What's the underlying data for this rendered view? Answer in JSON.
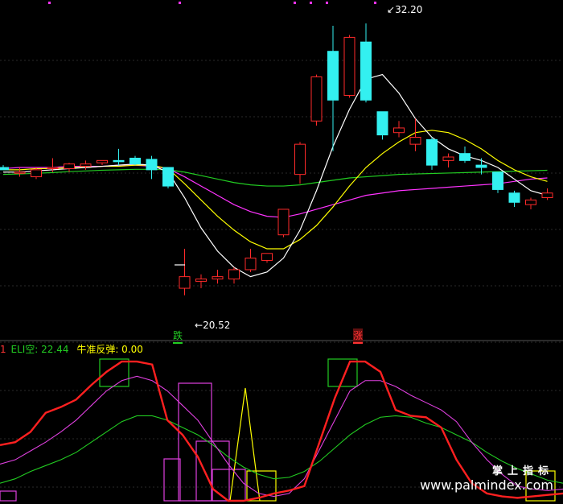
{
  "colors": {
    "background": "#000000",
    "up": "#ff2a2a",
    "down": "#33f0f0",
    "ma_white": "#ffffff",
    "ma_yellow": "#ffff00",
    "ma_magenta": "#ff33ff",
    "ma_green": "#22cc22",
    "grid": "#2a2a2a",
    "eli_red": "#ff2020",
    "eli_magenta": "#e040e0",
    "eli_green": "#22cc22",
    "box_green": "#22cc22",
    "box_yellow": "#ffff00",
    "box_magenta": "#e040e0"
  },
  "main": {
    "high_label": "32.20",
    "low_label": "20.52",
    "signal_down": "跌",
    "signal_up": "涨",
    "grid_lines": 6
  },
  "indicator": {
    "panel_index": "1",
    "name": "ELI空: 22.44",
    "value_label": "牛准反弹: 0.00"
  },
  "watermark": {
    "cn": "掌上指标",
    "url": "www.palmindex.com"
  },
  "chart_data": {
    "type": "candlestick",
    "price_range": [
      19.0,
      33.0
    ],
    "candles": [
      {
        "o": 26.0,
        "h": 26.1,
        "l": 25.9,
        "c": 25.9
      },
      {
        "o": 25.8,
        "h": 26.0,
        "l": 25.6,
        "c": 25.8
      },
      {
        "o": 25.6,
        "h": 26.0,
        "l": 25.5,
        "c": 25.9
      },
      {
        "o": 26.0,
        "h": 26.4,
        "l": 25.8,
        "c": 26.0
      },
      {
        "o": 25.95,
        "h": 26.2,
        "l": 25.8,
        "c": 26.15
      },
      {
        "o": 26.05,
        "h": 26.3,
        "l": 25.9,
        "c": 26.15
      },
      {
        "o": 26.2,
        "h": 26.3,
        "l": 26.1,
        "c": 26.3
      },
      {
        "o": 26.3,
        "h": 26.8,
        "l": 26.1,
        "c": 26.25
      },
      {
        "o": 26.4,
        "h": 26.5,
        "l": 26.1,
        "c": 26.15
      },
      {
        "o": 26.35,
        "h": 26.5,
        "l": 25.5,
        "c": 25.9
      },
      {
        "o": 26.0,
        "h": 26.0,
        "l": 25.1,
        "c": 25.2
      },
      {
        "o": 20.8,
        "h": 22.5,
        "l": 20.5,
        "c": 21.3
      },
      {
        "o": 21.1,
        "h": 21.4,
        "l": 20.8,
        "c": 21.2
      },
      {
        "o": 21.2,
        "h": 21.6,
        "l": 21.0,
        "c": 21.3
      },
      {
        "o": 21.2,
        "h": 21.7,
        "l": 21.0,
        "c": 21.6
      },
      {
        "o": 21.6,
        "h": 22.5,
        "l": 21.5,
        "c": 22.1
      },
      {
        "o": 22.0,
        "h": 22.3,
        "l": 21.9,
        "c": 22.3
      },
      {
        "o": 23.1,
        "h": 24.2,
        "l": 23.0,
        "c": 24.2
      },
      {
        "o": 25.7,
        "h": 27.1,
        "l": 25.3,
        "c": 27.0
      },
      {
        "o": 28.0,
        "h": 30.0,
        "l": 27.8,
        "c": 29.9
      },
      {
        "o": 31.0,
        "h": 32.1,
        "l": 26.7,
        "c": 28.9
      },
      {
        "o": 29.1,
        "h": 31.7,
        "l": 29.0,
        "c": 31.6
      },
      {
        "o": 31.4,
        "h": 32.2,
        "l": 28.8,
        "c": 28.9
      },
      {
        "o": 28.4,
        "h": 28.4,
        "l": 27.2,
        "c": 27.4
      },
      {
        "o": 27.5,
        "h": 28.0,
        "l": 27.3,
        "c": 27.7
      },
      {
        "o": 27.0,
        "h": 28.1,
        "l": 26.7,
        "c": 27.3
      },
      {
        "o": 27.2,
        "h": 27.3,
        "l": 25.9,
        "c": 26.1
      },
      {
        "o": 26.3,
        "h": 26.6,
        "l": 26.0,
        "c": 26.45
      },
      {
        "o": 26.6,
        "h": 26.9,
        "l": 26.2,
        "c": 26.3
      },
      {
        "o": 26.1,
        "h": 26.4,
        "l": 25.7,
        "c": 26.0
      },
      {
        "o": 25.8,
        "h": 25.8,
        "l": 24.9,
        "c": 25.05
      },
      {
        "o": 24.9,
        "h": 25.0,
        "l": 24.3,
        "c": 24.5
      },
      {
        "o": 24.4,
        "h": 24.7,
        "l": 24.2,
        "c": 24.6
      },
      {
        "o": 24.7,
        "h": 25.1,
        "l": 24.6,
        "c": 24.9
      }
    ],
    "ma_white": [
      25.8,
      25.8,
      25.85,
      25.9,
      25.95,
      26.0,
      26.05,
      26.1,
      26.15,
      26.1,
      25.8,
      24.7,
      23.4,
      22.4,
      21.7,
      21.3,
      21.5,
      22.1,
      23.3,
      25.0,
      26.9,
      28.5,
      29.8,
      30.0,
      29.2,
      28.1,
      27.3,
      26.8,
      26.5,
      26.3,
      26.0,
      25.5,
      25.0,
      24.8
    ],
    "ma_yellow": [
      25.9,
      25.9,
      25.95,
      25.95,
      26.0,
      26.0,
      26.05,
      26.05,
      26.1,
      26.1,
      25.95,
      25.3,
      24.6,
      23.9,
      23.3,
      22.8,
      22.5,
      22.5,
      22.9,
      23.5,
      24.3,
      25.2,
      26.0,
      26.6,
      27.1,
      27.5,
      27.6,
      27.5,
      27.2,
      26.8,
      26.3,
      25.9,
      25.6,
      25.4
    ],
    "ma_magenta": [
      25.95,
      26.0,
      26.0,
      26.0,
      26.05,
      26.05,
      26.05,
      26.1,
      26.1,
      26.05,
      25.95,
      25.6,
      25.2,
      24.8,
      24.4,
      24.1,
      23.9,
      23.85,
      24.0,
      24.2,
      24.4,
      24.6,
      24.8,
      24.9,
      25.0,
      25.05,
      25.1,
      25.15,
      25.2,
      25.25,
      25.3,
      25.4,
      25.5,
      25.55
    ],
    "ma_green": [
      25.7,
      25.72,
      25.75,
      25.78,
      25.82,
      25.85,
      25.88,
      25.9,
      25.92,
      25.92,
      25.9,
      25.8,
      25.65,
      25.5,
      25.35,
      25.25,
      25.2,
      25.2,
      25.25,
      25.35,
      25.45,
      25.55,
      25.6,
      25.65,
      25.7,
      25.72,
      25.74,
      25.76,
      25.78,
      25.8,
      25.82,
      25.84,
      25.86,
      25.88
    ],
    "eli_red": [
      38,
      40,
      47,
      60,
      64,
      69,
      79,
      88,
      95,
      95,
      93,
      55,
      45,
      30,
      8,
      0,
      0,
      2,
      5,
      7,
      10,
      40,
      70,
      95,
      95,
      88,
      62,
      58,
      57,
      50,
      28,
      12,
      5,
      3,
      2,
      3,
      4,
      5
    ],
    "eli_magenta": [
      25,
      28,
      34,
      40,
      47,
      55,
      65,
      75,
      82,
      85,
      82,
      75,
      65,
      55,
      40,
      25,
      12,
      5,
      3,
      5,
      15,
      35,
      55,
      75,
      82,
      82,
      78,
      72,
      67,
      62,
      54,
      40,
      28,
      18,
      10,
      8,
      7,
      8
    ],
    "eli_green": [
      12,
      15,
      20,
      24,
      28,
      33,
      40,
      47,
      54,
      58,
      58,
      55,
      50,
      45,
      38,
      30,
      23,
      18,
      15,
      16,
      20,
      27,
      36,
      45,
      52,
      57,
      58,
      57,
      53,
      50,
      45,
      40,
      33,
      27,
      22,
      18,
      14,
      12
    ]
  }
}
